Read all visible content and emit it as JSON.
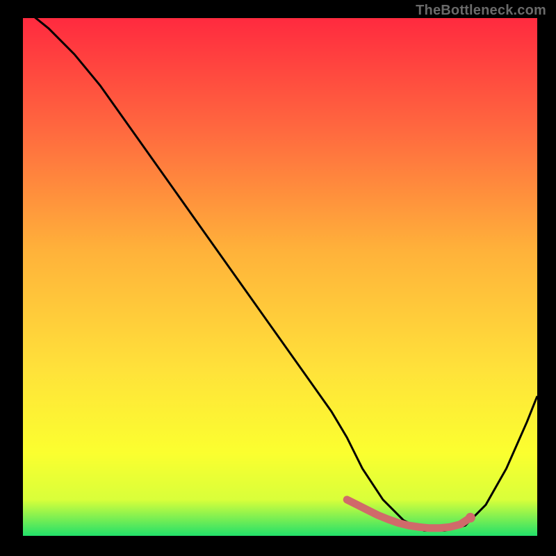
{
  "watermark": "TheBottleneck.com",
  "colors": {
    "background": "#000000",
    "gradient_top": "#ff2a3f",
    "gradient_mid_upper": "#ff6a3f",
    "gradient_mid": "#ffb23a",
    "gradient_mid_lower": "#ffe23a",
    "gradient_low": "#fbff2f",
    "gradient_bottom": "#22e06a",
    "curve": "#000000",
    "highlight_stroke": "#d06a6a",
    "highlight_fill": "#d06a6a"
  },
  "chart_data": {
    "type": "line",
    "title": "",
    "xlabel": "",
    "ylabel": "",
    "xlim": [
      0,
      100
    ],
    "ylim": [
      0,
      100
    ],
    "series": [
      {
        "name": "bottleneck-curve",
        "x": [
          0,
          5,
          10,
          15,
          20,
          25,
          30,
          35,
          40,
          45,
          50,
          55,
          60,
          63,
          66,
          70,
          74,
          78,
          82,
          86,
          90,
          94,
          98,
          100
        ],
        "y": [
          102,
          98,
          93,
          87,
          80,
          73,
          66,
          59,
          52,
          45,
          38,
          31,
          24,
          19,
          13,
          7,
          3,
          1,
          1,
          2,
          6,
          13,
          22,
          27
        ]
      }
    ],
    "highlight": {
      "name": "optimal-range",
      "points_x": [
        63,
        65,
        67,
        69,
        71,
        73,
        75,
        77,
        79,
        81,
        83,
        85,
        87
      ],
      "points_y": [
        7,
        6,
        5,
        4,
        3.2,
        2.5,
        2.0,
        1.7,
        1.5,
        1.5,
        1.7,
        2.2,
        3.5
      ],
      "end_dot": {
        "x": 87,
        "y": 3.5
      }
    }
  }
}
